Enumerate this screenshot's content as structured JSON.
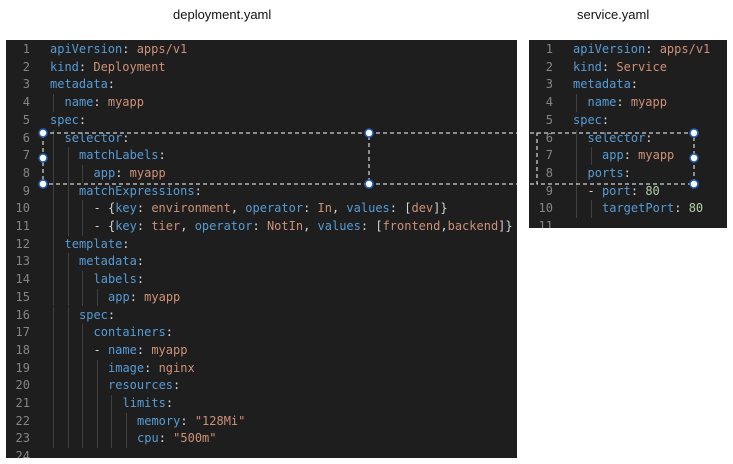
{
  "labels": {
    "deployment": "deployment.yaml",
    "service": "service.yaml"
  },
  "colors": {
    "key": "#569cd6",
    "string": "#ce9178",
    "number": "#b5cea8",
    "punct": "#d4d4d4",
    "line_number": "#858585",
    "background": "#1e1e1e"
  },
  "deployment_lines": [
    {
      "n": "1",
      "indent": 0,
      "parts": [
        [
          "k",
          "apiVersion"
        ],
        [
          "p",
          ": "
        ],
        [
          "v",
          "apps/v1"
        ]
      ]
    },
    {
      "n": "2",
      "indent": 0,
      "parts": [
        [
          "k",
          "kind"
        ],
        [
          "p",
          ": "
        ],
        [
          "v",
          "Deployment"
        ]
      ]
    },
    {
      "n": "3",
      "indent": 0,
      "parts": [
        [
          "k",
          "metadata"
        ],
        [
          "p",
          ":"
        ]
      ]
    },
    {
      "n": "4",
      "indent": 1,
      "parts": [
        [
          "k",
          "name"
        ],
        [
          "p",
          ": "
        ],
        [
          "v",
          "myapp"
        ]
      ]
    },
    {
      "n": "5",
      "indent": 0,
      "parts": [
        [
          "k",
          "spec"
        ],
        [
          "p",
          ":"
        ]
      ]
    },
    {
      "n": "6",
      "indent": 1,
      "parts": [
        [
          "k",
          "selector"
        ],
        [
          "p",
          ":"
        ]
      ]
    },
    {
      "n": "7",
      "indent": 2,
      "parts": [
        [
          "k",
          "matchLabels"
        ],
        [
          "p",
          ":"
        ]
      ]
    },
    {
      "n": "8",
      "indent": 3,
      "parts": [
        [
          "k",
          "app"
        ],
        [
          "p",
          ": "
        ],
        [
          "v",
          "myapp"
        ]
      ]
    },
    {
      "n": "9",
      "indent": 2,
      "parts": [
        [
          "k",
          "matchExpressions"
        ],
        [
          "p",
          ":"
        ]
      ]
    },
    {
      "n": "10",
      "indent": 3,
      "parts": [
        [
          "p",
          "- {"
        ],
        [
          "k",
          "key"
        ],
        [
          "p",
          ": "
        ],
        [
          "v",
          "environment"
        ],
        [
          "p",
          ", "
        ],
        [
          "k",
          "operator"
        ],
        [
          "p",
          ": "
        ],
        [
          "v",
          "In"
        ],
        [
          "p",
          ", "
        ],
        [
          "k",
          "values"
        ],
        [
          "p",
          ": ["
        ],
        [
          "v",
          "dev"
        ],
        [
          "p",
          "]}"
        ]
      ]
    },
    {
      "n": "11",
      "indent": 3,
      "parts": [
        [
          "p",
          "- {"
        ],
        [
          "k",
          "key"
        ],
        [
          "p",
          ": "
        ],
        [
          "v",
          "tier"
        ],
        [
          "p",
          ", "
        ],
        [
          "k",
          "operator"
        ],
        [
          "p",
          ": "
        ],
        [
          "v",
          "NotIn"
        ],
        [
          "p",
          ", "
        ],
        [
          "k",
          "values"
        ],
        [
          "p",
          ": ["
        ],
        [
          "v",
          "frontend"
        ],
        [
          "p",
          ","
        ],
        [
          "v",
          "backend"
        ],
        [
          "p",
          "]}"
        ]
      ]
    },
    {
      "n": "12",
      "indent": 1,
      "parts": [
        [
          "k",
          "template"
        ],
        [
          "p",
          ":"
        ]
      ]
    },
    {
      "n": "13",
      "indent": 2,
      "parts": [
        [
          "k",
          "metadata"
        ],
        [
          "p",
          ":"
        ]
      ]
    },
    {
      "n": "14",
      "indent": 3,
      "parts": [
        [
          "k",
          "labels"
        ],
        [
          "p",
          ":"
        ]
      ]
    },
    {
      "n": "15",
      "indent": 4,
      "parts": [
        [
          "k",
          "app"
        ],
        [
          "p",
          ": "
        ],
        [
          "v",
          "myapp"
        ]
      ]
    },
    {
      "n": "16",
      "indent": 2,
      "parts": [
        [
          "k",
          "spec"
        ],
        [
          "p",
          ":"
        ]
      ]
    },
    {
      "n": "17",
      "indent": 3,
      "parts": [
        [
          "k",
          "containers"
        ],
        [
          "p",
          ":"
        ]
      ]
    },
    {
      "n": "18",
      "indent": 3,
      "parts": [
        [
          "p",
          "- "
        ],
        [
          "k",
          "name"
        ],
        [
          "p",
          ": "
        ],
        [
          "v",
          "myapp"
        ]
      ]
    },
    {
      "n": "19",
      "indent": 4,
      "parts": [
        [
          "k",
          "image"
        ],
        [
          "p",
          ": "
        ],
        [
          "v",
          "nginx"
        ]
      ]
    },
    {
      "n": "20",
      "indent": 4,
      "parts": [
        [
          "k",
          "resources"
        ],
        [
          "p",
          ":"
        ]
      ]
    },
    {
      "n": "21",
      "indent": 5,
      "parts": [
        [
          "k",
          "limits"
        ],
        [
          "p",
          ":"
        ]
      ]
    },
    {
      "n": "22",
      "indent": 6,
      "parts": [
        [
          "k",
          "memory"
        ],
        [
          "p",
          ": "
        ],
        [
          "v",
          "\"128Mi\""
        ]
      ]
    },
    {
      "n": "23",
      "indent": 6,
      "parts": [
        [
          "k",
          "cpu"
        ],
        [
          "p",
          ": "
        ],
        [
          "v",
          "\"500m\""
        ]
      ]
    },
    {
      "n": "24",
      "indent": 0,
      "parts": []
    }
  ],
  "service_lines": [
    {
      "n": "1",
      "indent": 0,
      "parts": [
        [
          "k",
          "apiVersion"
        ],
        [
          "p",
          ": "
        ],
        [
          "v",
          "apps/v1"
        ]
      ]
    },
    {
      "n": "2",
      "indent": 0,
      "parts": [
        [
          "k",
          "kind"
        ],
        [
          "p",
          ": "
        ],
        [
          "v",
          "Service"
        ]
      ]
    },
    {
      "n": "3",
      "indent": 0,
      "parts": [
        [
          "k",
          "metadata"
        ],
        [
          "p",
          ":"
        ]
      ]
    },
    {
      "n": "4",
      "indent": 1,
      "parts": [
        [
          "k",
          "name"
        ],
        [
          "p",
          ": "
        ],
        [
          "v",
          "myapp"
        ]
      ]
    },
    {
      "n": "5",
      "indent": 0,
      "parts": [
        [
          "k",
          "spec"
        ],
        [
          "p",
          ":"
        ]
      ]
    },
    {
      "n": "6",
      "indent": 1,
      "parts": [
        [
          "k",
          "selector"
        ],
        [
          "p",
          ":"
        ]
      ]
    },
    {
      "n": "7",
      "indent": 2,
      "parts": [
        [
          "k",
          "app"
        ],
        [
          "p",
          ": "
        ],
        [
          "v",
          "myapp"
        ]
      ]
    },
    {
      "n": "8",
      "indent": 1,
      "parts": [
        [
          "k",
          "ports"
        ],
        [
          "p",
          ":"
        ]
      ]
    },
    {
      "n": "9",
      "indent": 1,
      "parts": [
        [
          "p",
          "- "
        ],
        [
          "k",
          "port"
        ],
        [
          "p",
          ": "
        ],
        [
          "n",
          "80"
        ]
      ]
    },
    {
      "n": "10",
      "indent": 2,
      "parts": [
        [
          "k",
          "targetPort"
        ],
        [
          "p",
          ": "
        ],
        [
          "n",
          "80"
        ]
      ]
    },
    {
      "n": "11",
      "indent": 0,
      "parts": []
    }
  ]
}
